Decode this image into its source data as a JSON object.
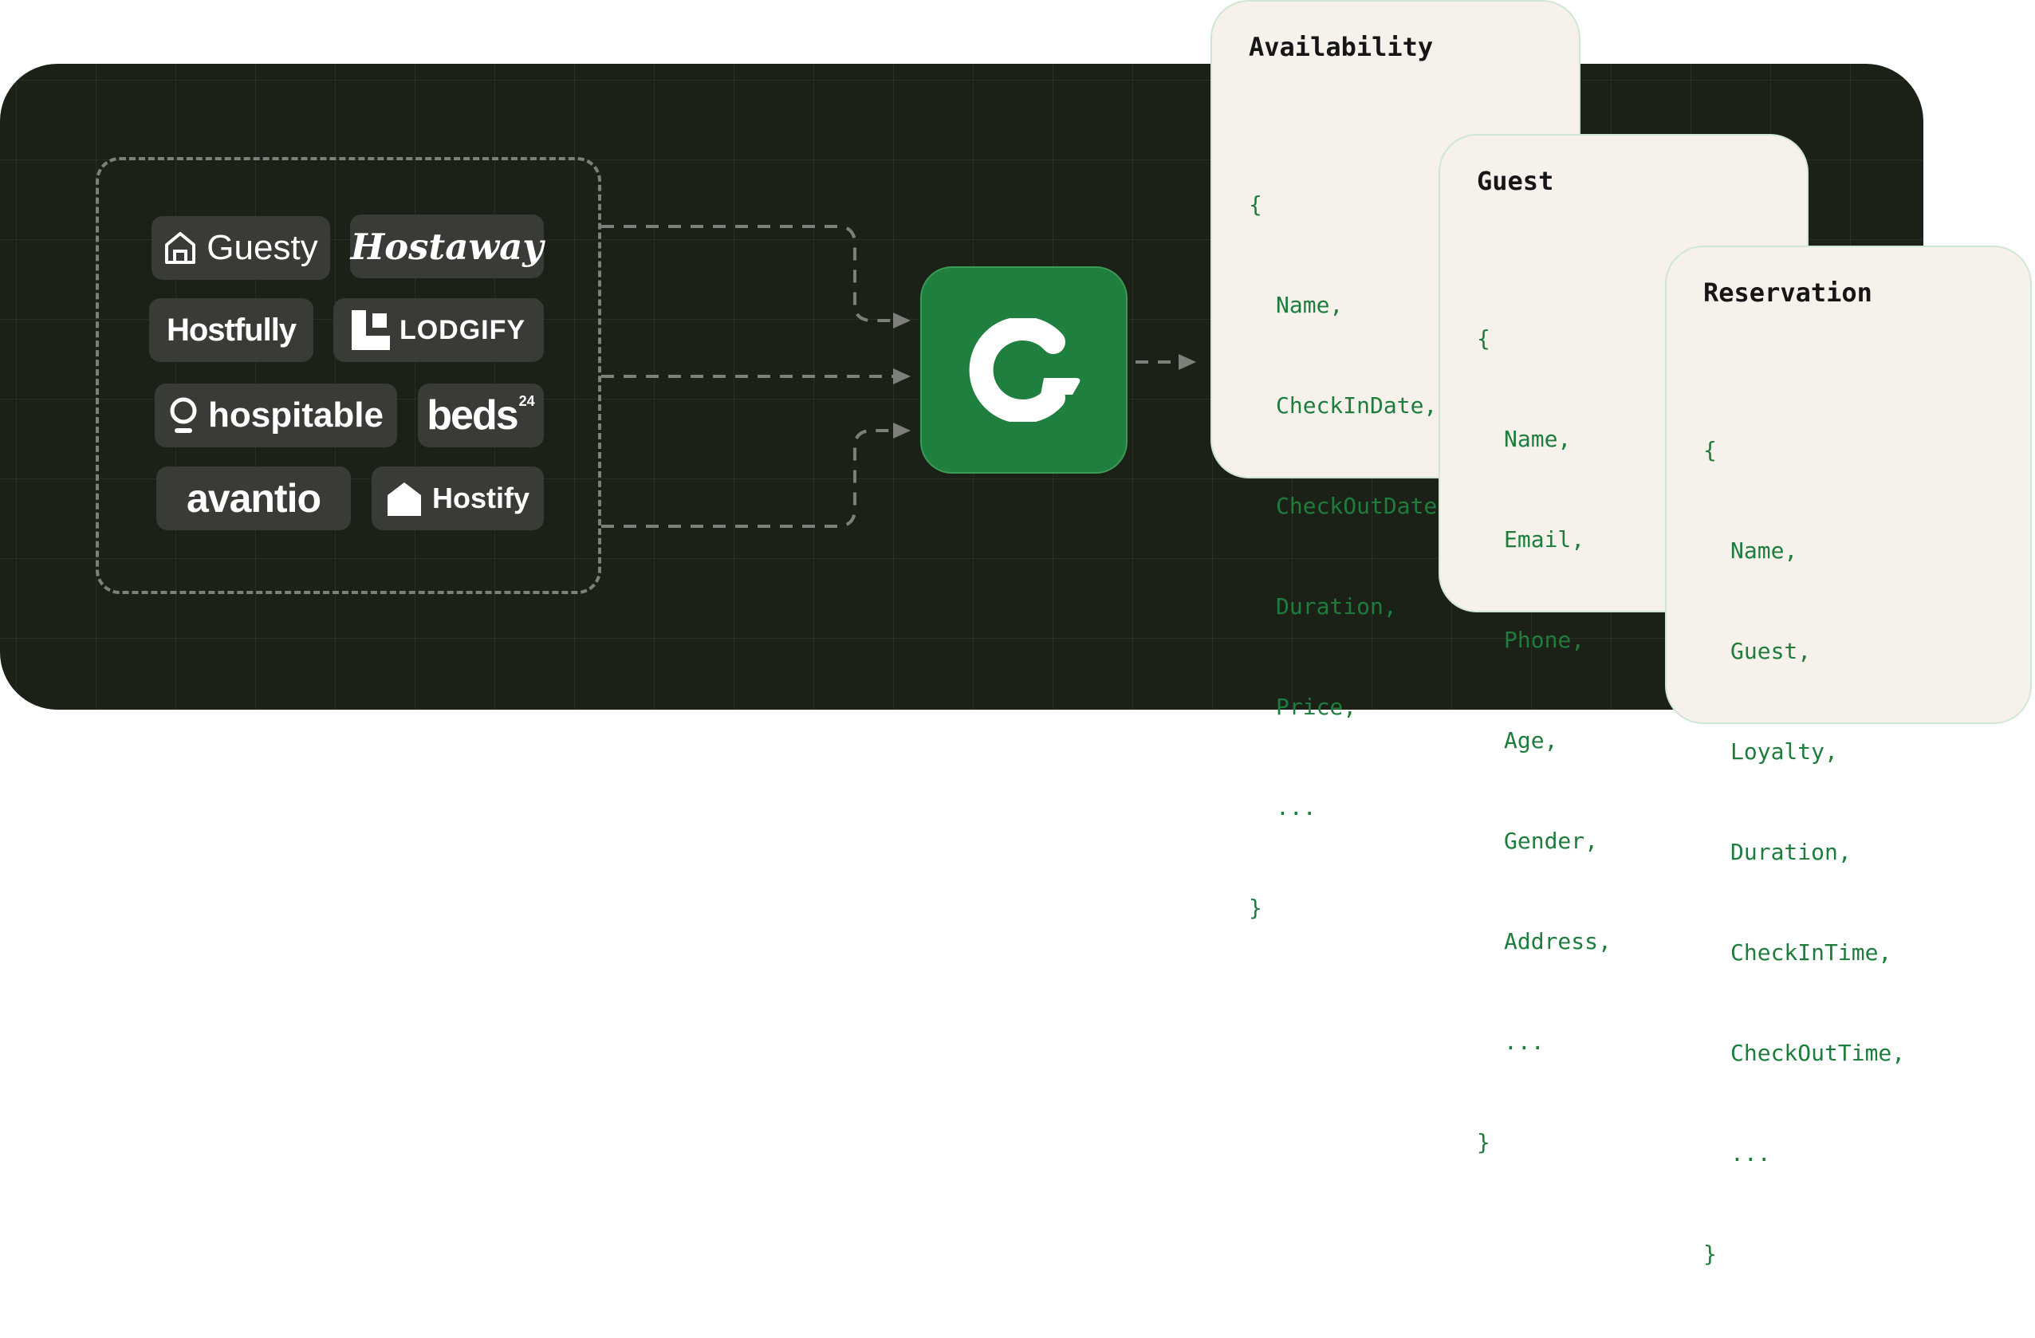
{
  "colors": {
    "stage_background": "#1b2117",
    "logo_tile": "#393b37",
    "hub_green": "#1f7f3e",
    "card_background": "#f7f1ec",
    "code_green": "#1d7d3c",
    "dashed_line": "#7d807a"
  },
  "integrations": [
    {
      "label": "Guesty",
      "icon": "house-outline-icon"
    },
    {
      "label": "Hostaway",
      "icon": null
    },
    {
      "label": "Hostfully",
      "icon": null
    },
    {
      "label": "LODGIFY",
      "icon": "lodgify-mark-icon"
    },
    {
      "label": "hospitable",
      "icon": "location-pin-icon"
    },
    {
      "label": "beds",
      "superscript": "24",
      "icon": null
    },
    {
      "label": "avantio",
      "icon": null
    },
    {
      "label": "Hostify",
      "icon": "house-solid-icon"
    }
  ],
  "hub": {
    "icon": "c-logo-icon"
  },
  "cards": {
    "availability": {
      "title": "Availability",
      "lines": [
        "{",
        "Name,",
        "CheckInDate,",
        "CheckOutDate",
        "Duration,",
        "Price,",
        "...",
        "}"
      ]
    },
    "guest": {
      "title": "Guest",
      "lines": [
        "{",
        "Name,",
        "Email,",
        "Phone,",
        "Age,",
        "Gender,",
        "Address,",
        "...",
        "}"
      ]
    },
    "reservation": {
      "title": "Reservation",
      "lines": [
        "{",
        "Name,",
        "Guest,",
        "Loyalty,",
        "Duration,",
        "CheckInTime,",
        "CheckOutTime,",
        "...",
        "}"
      ]
    }
  }
}
